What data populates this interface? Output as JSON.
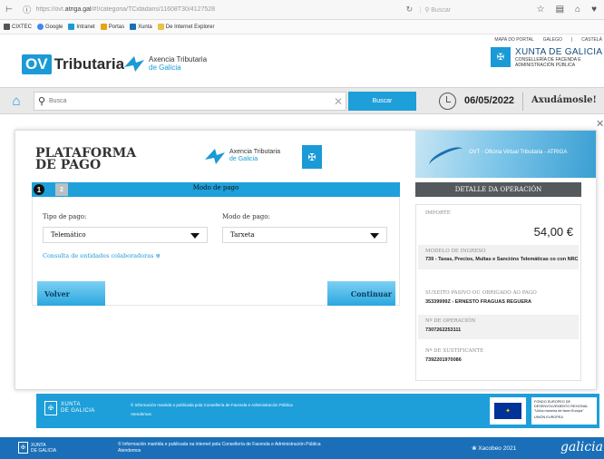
{
  "browser": {
    "url_prefix": "https://ovt.",
    "url_domain": "atriga.gal",
    "url_path": "/#!/categoria/TCidadans/11608T30/4127528",
    "search_placeholder": "Buscar",
    "bookmarks": [
      {
        "label": "CIXTEC",
        "icon": "cixtec-icon",
        "color": "#555555"
      },
      {
        "label": "Google",
        "icon": "google-icon",
        "color": "#4285f4"
      },
      {
        "label": "Intranet",
        "icon": "intranet-icon",
        "color": "#1a9ad6"
      },
      {
        "label": "Portas",
        "icon": "portas-icon",
        "color": "#e8a317"
      },
      {
        "label": "Xunta",
        "icon": "xunta-icon",
        "color": "#1a6fb8"
      },
      {
        "label": "De Internet Explorer",
        "icon": "folder-icon",
        "color": "#e8c24a"
      }
    ]
  },
  "header": {
    "top_links": [
      "MAPA DO PORTAL",
      "GALEGO",
      "|",
      "CASTELÁ"
    ],
    "ov_badge": "OV",
    "ov_text": "Tributaria",
    "atg_line1": "Axencia Tributaria",
    "atg_line2": "de Galicia",
    "xunta_line1": "XUNTA DE GALICIA",
    "xunta_line2": "CONSELLERÍA DE FACENDA E",
    "xunta_line3": "ADMINISTRACIÓN PÚBLICA"
  },
  "searchbar": {
    "placeholder": "Busca",
    "button": "Buscar",
    "date": "06/05/2022",
    "help": "Axudámosle!"
  },
  "modal": {
    "title_line1": "PLATAFORMA",
    "title_line2a": "DE ",
    "title_line2b": "PAGO",
    "atg_line1": "Axencia Tributaria",
    "atg_line2": "de Galicia",
    "banner_label": "OVT - Oficina Virtual Tributaria - ATRIGA",
    "steps": [
      "1",
      "2"
    ],
    "steps_title": "Modo de pago",
    "tipo_label": "Tipo de pago:",
    "tipo_value": "Telemático",
    "modo_label": "Modo de pago:",
    "modo_value": "Tarxeta",
    "consult_link": "Consulta de entidades colaboradoras",
    "back_button": "Volver",
    "continue_button": "Continuar",
    "detail_title": "DETALLE DA OPERACIÓN",
    "importe_label": "IMPORTE",
    "importe_value": "54,00 €",
    "modelo_label": "MODELO DE INGRESO",
    "modelo_value": "739 - Taxas, Precios, Multas e Sancións Telemáticas co con NRC",
    "suxeito_label": "SUXEITO PASIVO OU OBRIGADO AO PAGO",
    "suxeito_value": "35339999Z - ERNESTO FRAGUAS REGUERA",
    "operacion_label": "Nº DE OPERACIÓN",
    "operacion_value": "7307262253111",
    "xustificante_label": "Nº DE XUSTIFICANTE",
    "xustificante_value": "7392201970086"
  },
  "footer_modal": {
    "xunta_line1": "XUNTA",
    "xunta_line2": "DE GALICIA",
    "info_line1": "© Información mantida e publicada pola Consellería de Facenda e Administración Pública",
    "info_line2": "Atendemos",
    "feder_text": "FONDO EUROPEO DE DESENVOLVEMENTO REXIONAL \"Unha maneira de facer Europa\"",
    "eu_label": "UNIÓN EUROPEA"
  },
  "footer_page": {
    "xunta_line1": "XUNTA",
    "xunta_line2": "DE GALICIA",
    "info_line1": "© Información mantida e publicada na internet pola Consellería de Facenda e Administración Pública",
    "info_line2": "Atendemos",
    "xacobeo": "Xacobeo 2021",
    "galicia": "galicia"
  },
  "colors": {
    "accent": "#1e9fd9",
    "dark_panel": "#54595d",
    "footer_dark": "#1a6fb8"
  }
}
